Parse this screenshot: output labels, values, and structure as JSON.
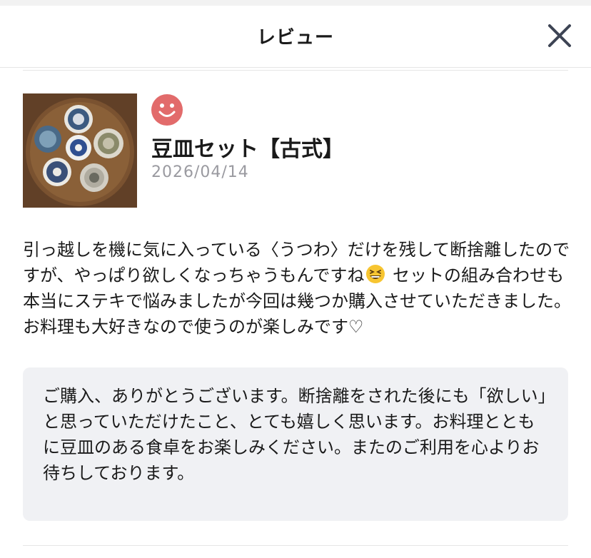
{
  "header": {
    "title": "レビュー",
    "close_icon": "close-icon"
  },
  "review": {
    "product_title": "豆皿セット【古式】",
    "date": "2026/04/14",
    "rating_icon": "smiley-face-icon",
    "rating_color": "#e26b6b",
    "body_part1": "引っ越しを機に気に入っている〈うつわ〉だけを残して断捨離したのですが、やっぱり欲しくなっちゃうもんですね",
    "emoji_icon": "grinning-squinting-face-icon",
    "body_part2": " セットの組み合わせも本当にステキで悩みましたが今回は幾つか購入させていただきました。お料理も大好きなので使うのが楽しみです♡"
  },
  "reply": {
    "text": "ご購入、ありがとうございます。断捨離をされた後にも「欲しい」と思っていただけたこと、とても嬉しく思います。お料理とともに豆皿のある食卓をお楽しみください。またのご利用を心よりお待ちしております。"
  },
  "colors": {
    "reply_background": "#f0f1f4",
    "date_text": "#9a9aa0"
  }
}
